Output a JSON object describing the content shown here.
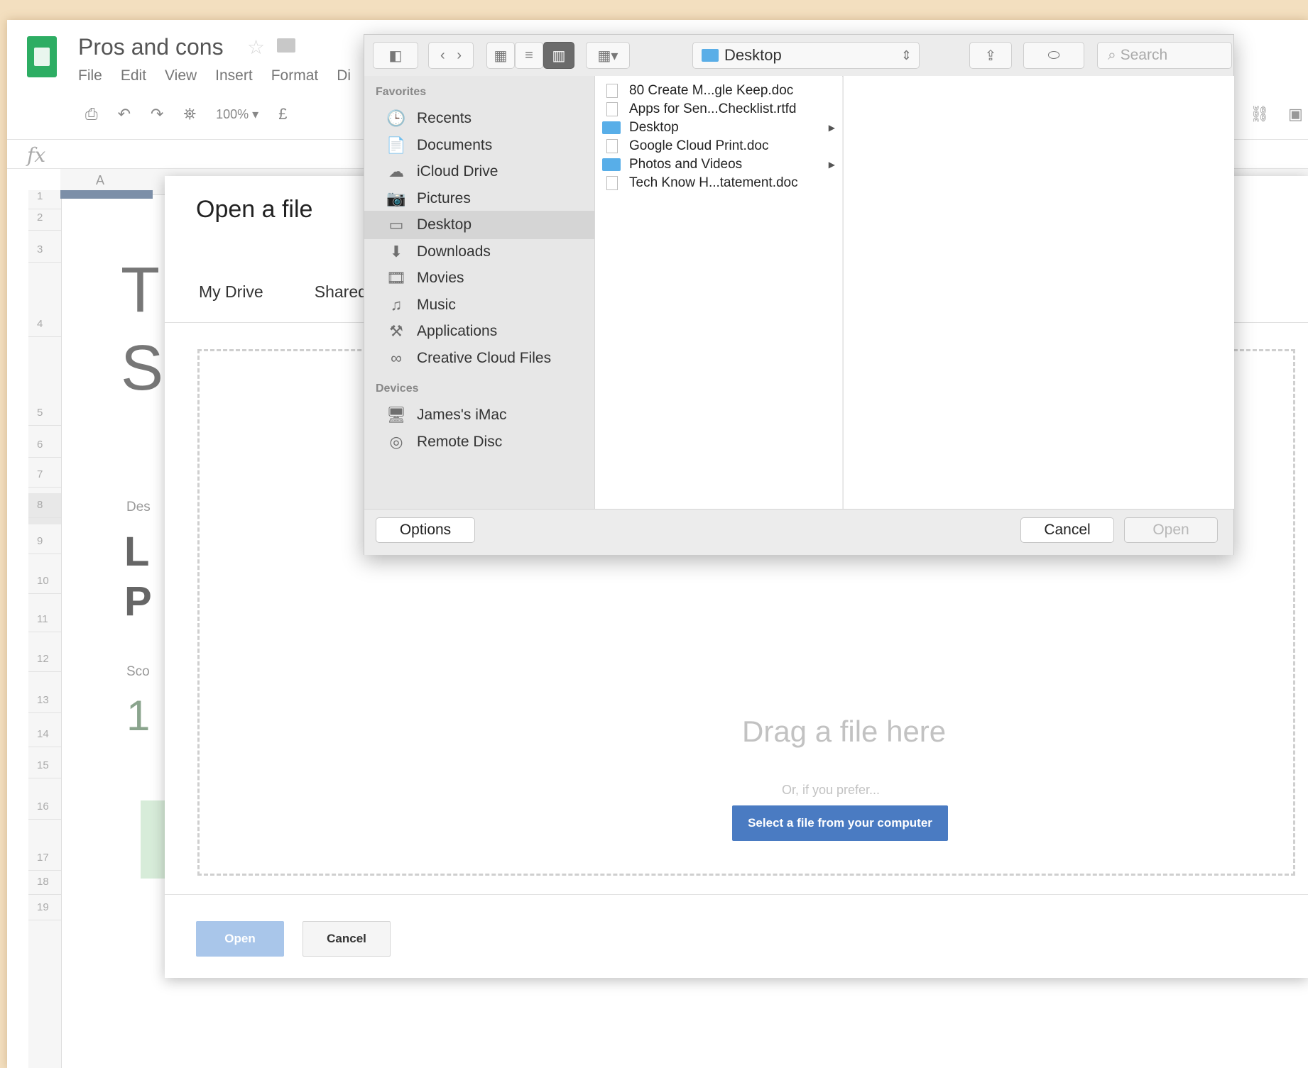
{
  "sheets": {
    "doc_title": "Pros and cons",
    "menu": [
      "File",
      "Edit",
      "View",
      "Insert",
      "Format",
      "Di"
    ],
    "toolbar": {
      "print": "⎙",
      "undo": "↶",
      "redo": "↷",
      "paint_format": "⛯",
      "zoom": "100%",
      "zoom_caret": "▾",
      "currency": "£"
    },
    "toolbar_right": [
      "⛓",
      "▣"
    ],
    "fx_label": "fx",
    "column_a": "A",
    "rows": [
      "1",
      "2",
      "3",
      "4",
      "5",
      "6",
      "7",
      "8",
      "9",
      "10",
      "11",
      "12",
      "13",
      "14",
      "15",
      "16",
      "17",
      "18",
      "19"
    ],
    "peeks": {
      "t": "T",
      "s": "S",
      "des": "Des",
      "l": "L",
      "p": "P",
      "sco": "Sco",
      "num": "1"
    }
  },
  "picker": {
    "title": "Open a file",
    "tabs": [
      "My Drive",
      "Shared"
    ],
    "drag_text": "Drag a file here",
    "or_text": "Or, if you prefer...",
    "select_button": "Select a file from your computer",
    "open_button": "Open",
    "cancel_button": "Cancel"
  },
  "mac_panel": {
    "path": "Desktop",
    "search_placeholder": "Search",
    "favorites_label": "Favorites",
    "favorites": [
      {
        "label": "Recents",
        "icon": "clock-icon",
        "glyph": "🕒"
      },
      {
        "label": "Documents",
        "icon": "documents-icon",
        "glyph": "📄"
      },
      {
        "label": "iCloud Drive",
        "icon": "cloud-icon",
        "glyph": "☁"
      },
      {
        "label": "Pictures",
        "icon": "camera-icon",
        "glyph": "📷"
      },
      {
        "label": "Desktop",
        "icon": "desktop-icon",
        "glyph": "▭",
        "selected": true
      },
      {
        "label": "Downloads",
        "icon": "download-icon",
        "glyph": "⬇"
      },
      {
        "label": "Movies",
        "icon": "film-icon",
        "glyph": "🎞"
      },
      {
        "label": "Music",
        "icon": "music-icon",
        "glyph": "♫"
      },
      {
        "label": "Applications",
        "icon": "applications-icon",
        "glyph": "⚒"
      },
      {
        "label": "Creative Cloud Files",
        "icon": "creative-cloud-icon",
        "glyph": "∞"
      }
    ],
    "devices_label": "Devices",
    "devices": [
      {
        "label": "James's iMac",
        "icon": "imac-icon",
        "glyph": "🖥"
      },
      {
        "label": "Remote Disc",
        "icon": "disc-icon",
        "glyph": "◎"
      }
    ],
    "files": [
      {
        "name": "80 Create M...gle Keep.doc",
        "type": "file"
      },
      {
        "name": "Apps for Sen...Checklist.rtfd",
        "type": "file"
      },
      {
        "name": "Desktop",
        "type": "folder"
      },
      {
        "name": "Google Cloud Print.doc",
        "type": "file"
      },
      {
        "name": "Photos and Videos",
        "type": "folder"
      },
      {
        "name": "Tech Know H...tatement.doc",
        "type": "file"
      }
    ],
    "options_button": "Options",
    "cancel_button": "Cancel",
    "open_button": "Open"
  }
}
